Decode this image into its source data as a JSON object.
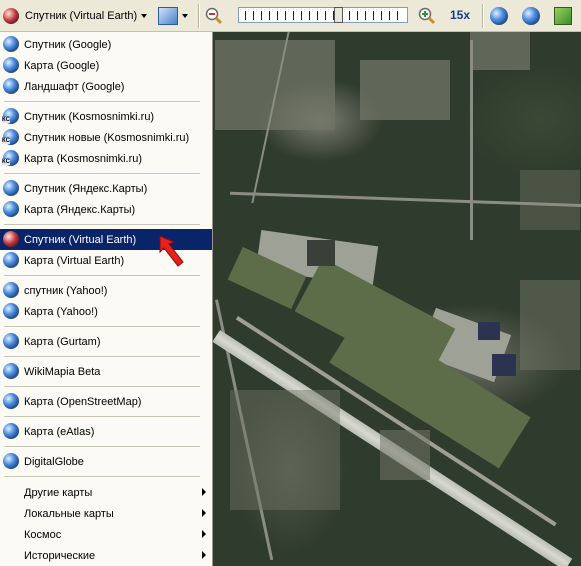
{
  "toolbar": {
    "source_label": "Спутник (Virtual Earth)",
    "zoom_level": "15x",
    "zoom_slider_value": 0.6
  },
  "menu": {
    "items": [
      {
        "label": "Спутник (Google)",
        "icon": "globe-icon"
      },
      {
        "label": "Карта (Google)",
        "icon": "globe-icon"
      },
      {
        "label": "Ландшафт (Google)",
        "icon": "globe-icon"
      },
      {
        "label": "Спутник (Kosmosnimki.ru)",
        "icon": "kosmosnimki-globe-icon",
        "badge": "КС"
      },
      {
        "label": "Спутник новые (Kosmosnimki.ru)",
        "icon": "kosmosnimki-globe-icon",
        "badge": "КС"
      },
      {
        "label": "Карта (Kosmosnimki.ru)",
        "icon": "kosmosnimki-globe-icon",
        "badge": "КС"
      },
      {
        "label": "Спутник (Яндекс.Карты)",
        "icon": "globe-icon"
      },
      {
        "label": "Карта (Яндекс.Карты)",
        "icon": "globe-icon"
      },
      {
        "label": "Спутник (Virtual Earth)",
        "icon": "virtual-earth-icon",
        "selected": true
      },
      {
        "label": "Карта (Virtual Earth)",
        "icon": "globe-icon"
      },
      {
        "label": "спутник (Yahoo!)",
        "icon": "globe-icon"
      },
      {
        "label": "Карта (Yahoo!)",
        "icon": "globe-icon"
      },
      {
        "label": "Карта (Gurtam)",
        "icon": "globe-icon"
      },
      {
        "label": "WikiMapia Beta",
        "icon": "globe-icon"
      },
      {
        "label": "Карта (OpenStreetMap)",
        "icon": "globe-icon"
      },
      {
        "label": "Карта (eAtlas)",
        "icon": "globe-icon"
      },
      {
        "label": "DigitalGlobe",
        "icon": "globe-icon"
      }
    ],
    "submenus": [
      {
        "label": "Другие карты"
      },
      {
        "label": "Локальные карты"
      },
      {
        "label": "Космос"
      },
      {
        "label": "Исторические"
      }
    ]
  },
  "colors": {
    "menu_highlight": "#0a246a",
    "pointer": "#e8201c"
  }
}
